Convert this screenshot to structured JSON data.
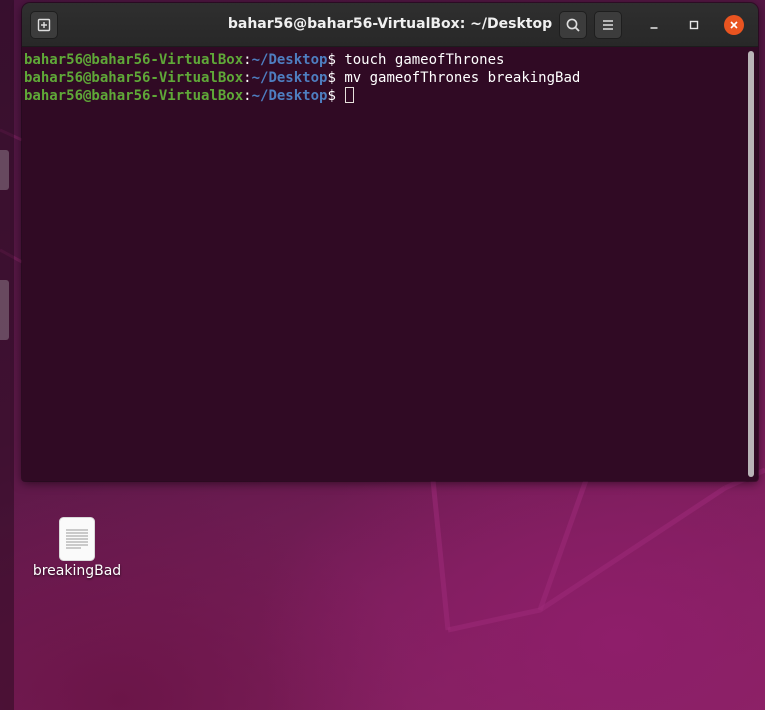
{
  "terminal": {
    "title": "bahar56@bahar56-VirtualBox: ~/Desktop",
    "buttons": {
      "new_tab_icon": "new-tab-icon",
      "search_icon": "search-icon",
      "menu_icon": "hamburger-menu-icon",
      "minimize_icon": "minimize-icon",
      "maximize_icon": "maximize-icon",
      "close_icon": "close-icon"
    },
    "prompt": {
      "user_host": "bahar56@bahar56-VirtualBox",
      "colon": ":",
      "path": "~/Desktop",
      "dollar": "$"
    },
    "lines": [
      {
        "command": " touch gameofThrones"
      },
      {
        "command": " mv gameofThrones breakingBad"
      },
      {
        "command": " "
      }
    ]
  },
  "desktop": {
    "file": {
      "label": "breakingBad",
      "icon": "text-document-icon"
    }
  },
  "colors": {
    "terminal_bg": "#300a24",
    "prompt_user": "#5fa838",
    "prompt_path": "#4e7ec0",
    "close_button": "#e95420",
    "titlebar": "#2c2c2c"
  }
}
